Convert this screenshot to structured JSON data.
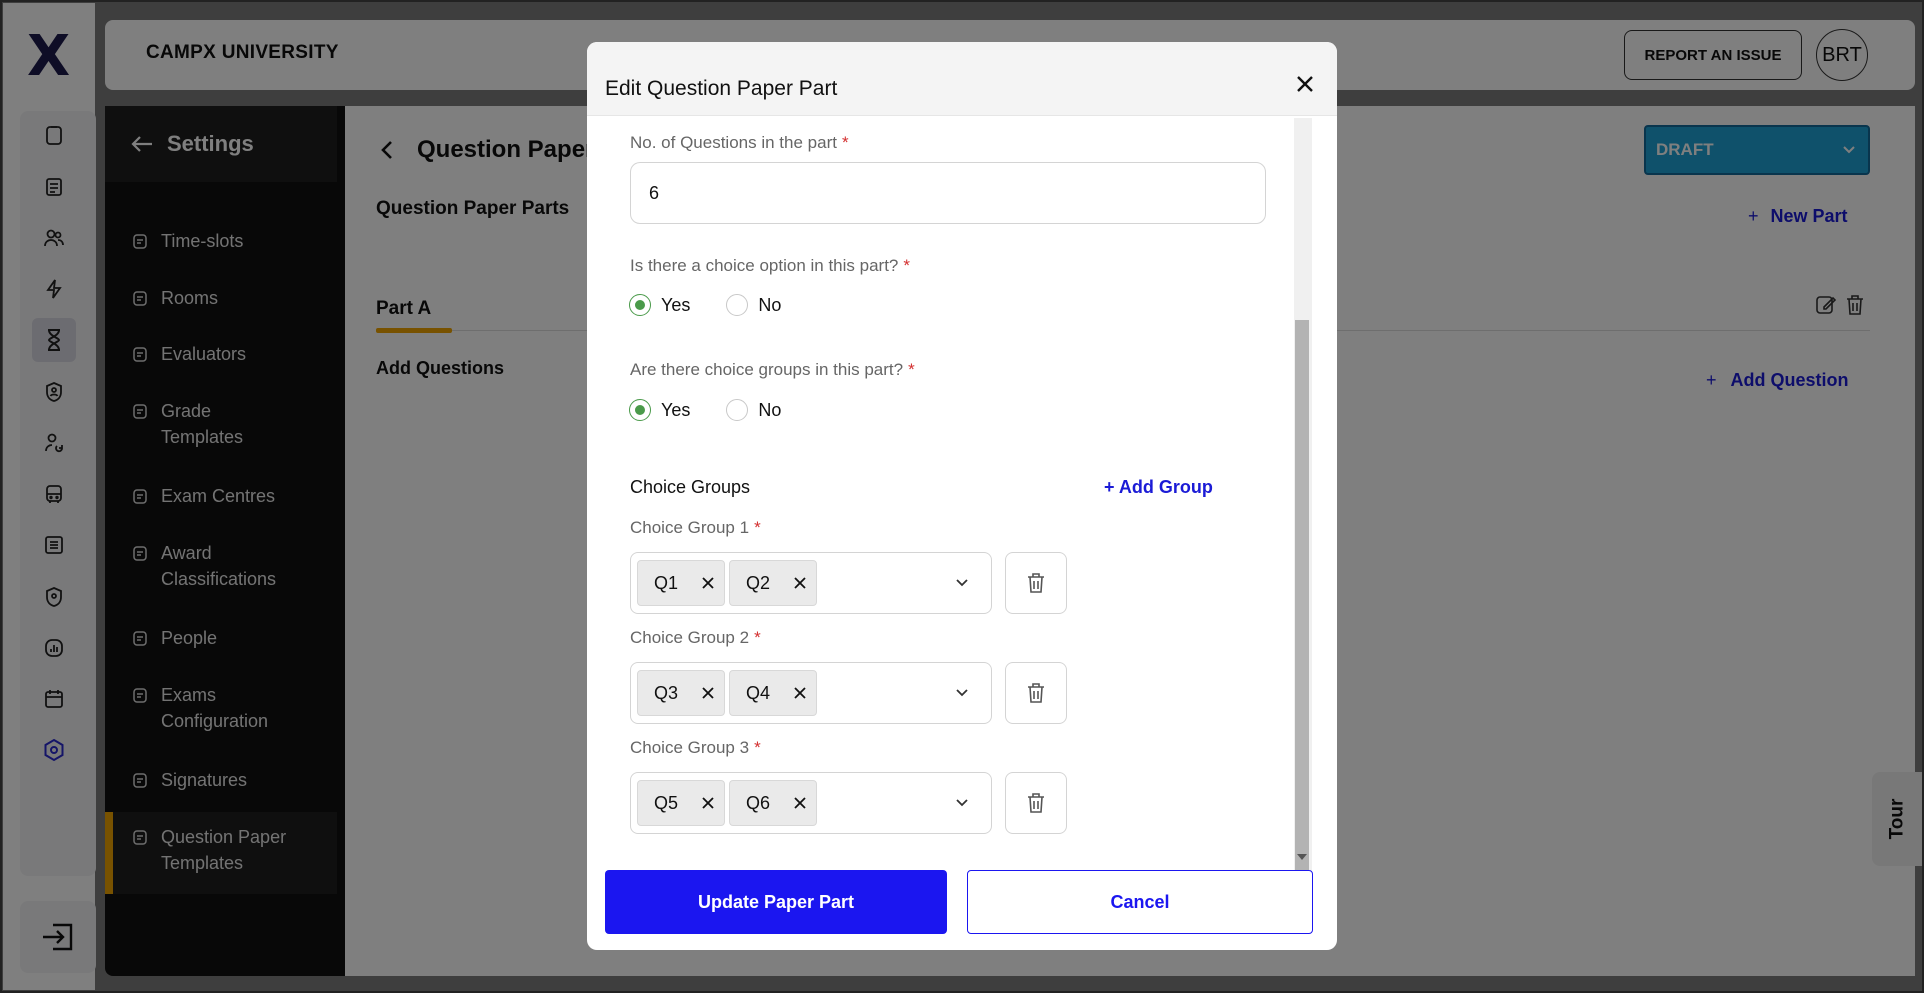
{
  "app": {
    "logo": "X",
    "university": "CAMPX UNIVERSITY",
    "report_label": "REPORT AN ISSUE",
    "avatar_initials": "BRT"
  },
  "rail": {
    "icons": [
      "clipboard-icon",
      "document-icon",
      "users-icon",
      "bolt-icon",
      "hourglass-icon",
      "shield-user-icon",
      "user-refresh-icon",
      "bus-icon",
      "list-icon",
      "shield-pin-icon",
      "chart-icon",
      "calendar-icon",
      "settings-hex-icon"
    ],
    "active_index": 4,
    "logout_icon": "logout-icon"
  },
  "sidebar": {
    "title": "Settings",
    "items": [
      {
        "label": "Time-slots",
        "icon": "timer-icon"
      },
      {
        "label": "Rooms",
        "icon": "rooms-icon"
      },
      {
        "label": "Evaluators",
        "icon": "user-icon"
      },
      {
        "label": "Grade\nTemplates",
        "icon": "palette-icon"
      },
      {
        "label": "Exam Centres",
        "icon": "building-icon"
      },
      {
        "label": "Award\nClassifications",
        "icon": "graduation-cap-icon"
      },
      {
        "label": "People",
        "icon": "people-icon"
      },
      {
        "label": "Exams\nConfiguration",
        "icon": "clipboard-check-icon"
      },
      {
        "label": "Signatures",
        "icon": "signature-icon"
      },
      {
        "label": "Question Paper\nTemplates",
        "icon": "edit-doc-icon"
      }
    ],
    "active_index": 9
  },
  "page": {
    "title": "Question Paper",
    "section_label": "Question Paper Parts",
    "status": "DRAFT",
    "new_part_label": "New Part",
    "part_tab": "Part A",
    "add_questions_label": "Add Questions",
    "add_question_button": "Add Question",
    "tour_label": "Tour"
  },
  "modal": {
    "title": "Edit Question Paper Part",
    "num_questions_label": "No. of Questions in the part",
    "num_questions_value": "6",
    "choice_option_label": "Is there a choice option in this part?",
    "choice_groups_question": "Are there choice groups in this part?",
    "yes": "Yes",
    "no": "No",
    "choice_option_selected": "Yes",
    "choice_groups_selected": "Yes",
    "choice_groups_title": "Choice Groups",
    "add_group": "+ Add Group",
    "groups": [
      {
        "label": "Choice Group 1",
        "chips": [
          "Q1",
          "Q2"
        ]
      },
      {
        "label": "Choice Group 2",
        "chips": [
          "Q3",
          "Q4"
        ]
      },
      {
        "label": "Choice Group 3",
        "chips": [
          "Q5",
          "Q6"
        ]
      }
    ],
    "required_mark": "*",
    "update_button": "Update Paper Part",
    "cancel_button": "Cancel"
  }
}
